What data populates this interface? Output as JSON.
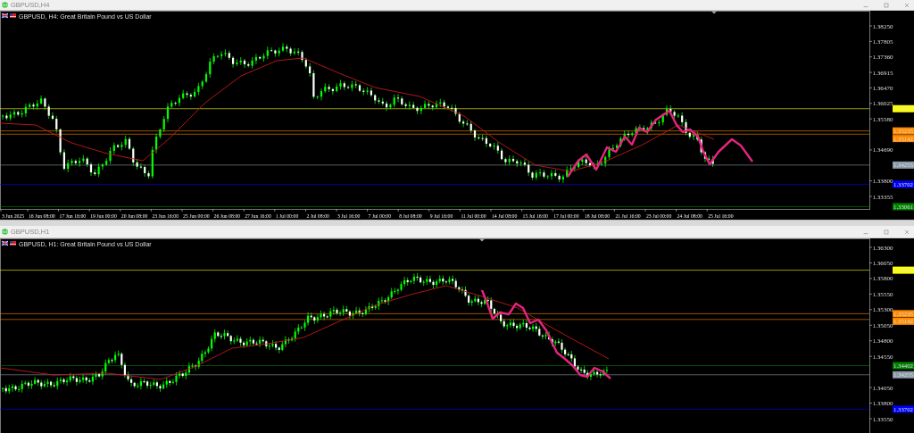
{
  "windows": [
    {
      "title": "GBPUSD,H4",
      "caption": "GBPUSD, H4: Great Britain Pound vs US Dollar",
      "price_axis": [
        "1.38250",
        "1.37805",
        "1.37360",
        "1.36915",
        "1.36470",
        "1.36025",
        "1.35580",
        "1.34690",
        "1.33800",
        "1.33355"
      ],
      "price_lines": [
        {
          "label": "1.35873",
          "color": "#ffff00"
        },
        {
          "label": "1.35235",
          "color": "#ff8c00"
        },
        {
          "label": "1.35142",
          "color": "#ff8c00"
        },
        {
          "label": "1.34255",
          "color": "#8c9aa8"
        },
        {
          "label": "1.33702",
          "color": "#0000ff"
        },
        {
          "label": "1.33061",
          "color": "#008000"
        }
      ],
      "time_axis": [
        "3 Jun 2025",
        "16 Jun 08:00",
        "17 Jun 16:00",
        "19 Jun 00:00",
        "20 Jun 08:00",
        "23 Jun 16:00",
        "25 Jun 00:00",
        "26 Jun 08:00",
        "27 Jun 16:00",
        "1 Jul 00:00",
        "2 Jul 08:00",
        "3 Jul 16:00",
        "7 Jul 00:00",
        "8 Jul 08:00",
        "9 Jul 16:00",
        "11 Jul 00:00",
        "14 Jul 08:00",
        "15 Jul 16:00",
        "17 Jul 00:00",
        "18 Jul 08:00",
        "21 Jul 16:00",
        "23 Jul 00:00",
        "24 Jul 08:00",
        "25 Jul 16:00"
      ]
    },
    {
      "title": "GBPUSD,H1",
      "caption": "GBPUSD, H1: Great Britain Pound vs US Dollar",
      "price_axis": [
        "1.36300",
        "1.36050",
        "1.35800",
        "1.35550",
        "1.35300",
        "1.35050",
        "1.34800",
        "1.34550",
        "1.34050",
        "1.33800",
        "1.33550"
      ],
      "price_lines": [
        {
          "label": "1.35933",
          "color": "#ffff00"
        },
        {
          "label": "1.35235",
          "color": "#ff8c00"
        },
        {
          "label": "1.35142",
          "color": "#ff8c00"
        },
        {
          "label": "1.34402",
          "color": "#008000"
        },
        {
          "label": "1.34255",
          "color": "#8c9aa8"
        },
        {
          "label": "1.33702",
          "color": "#0000ff"
        }
      ]
    }
  ]
}
